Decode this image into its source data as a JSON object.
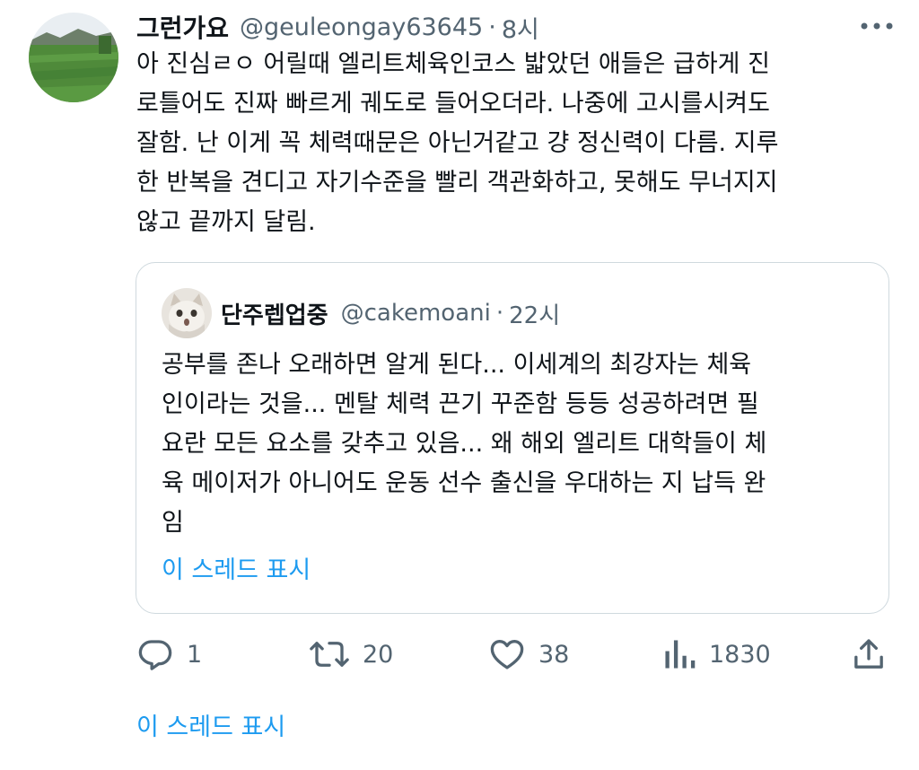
{
  "tweet": {
    "display_name": "그런가요",
    "handle": "@geuleongay63645",
    "separator": "·",
    "time": "8시",
    "text": "아 진심ㄹㅇ 어릴때 엘리트체육인코스 밟았던 애들은 급하게 진\n로틀어도 진짜 빠르게 궤도로 들어오더라. 나중에 고시를시켜도\n잘함. 난 이게 꼭 체력때문은 아닌거같고 걍 정신력이 다름. 지루\n한 반복을 견디고 자기수준을 빨리 객관화하고, 못해도 무너지지\n않고 끝까지 달림."
  },
  "quote": {
    "display_name": "단주렙업중",
    "handle": "@cakemoani",
    "separator": "·",
    "time": "22시",
    "text": "공부를 존나 오래하면 알게 된다... 이세계의 최강자는 체육\n인이라는 것을... 멘탈 체력 끈기 꾸준함 등등 성공하려면 필\n요란 모든 요소를 갖추고 있음... 왜 해외 엘리트 대학들이 체\n육 메이저가 아니어도 운동 선수 출신을 우대하는 지 납득 완\n임",
    "show_thread": "이 스레드 표시"
  },
  "actions": {
    "reply": {
      "icon": "reply-icon",
      "count": "1"
    },
    "retweet": {
      "icon": "retweet-icon",
      "count": "20"
    },
    "like": {
      "icon": "heart-icon",
      "count": "38"
    },
    "views": {
      "icon": "views-icon",
      "count": "1830"
    },
    "share": {
      "icon": "share-icon"
    }
  },
  "show_thread": "이 스레드 표시",
  "colors": {
    "text": "#0f1419",
    "secondary": "#536471",
    "link": "#1d9bf0",
    "border": "#cfd9de"
  }
}
